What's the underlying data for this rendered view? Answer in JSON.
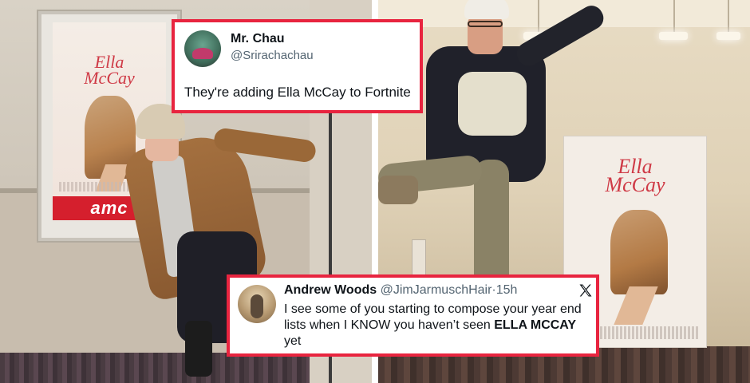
{
  "tweet_top": {
    "name": "Mr. Chau",
    "handle": "@Srirachachau",
    "text": "They're adding Ella McCay to Fortnite"
  },
  "tweet_bottom": {
    "name": "Andrew Woods",
    "handle": "@JimJarmuschHair",
    "separator": "·",
    "time": "15h",
    "text_before": "I see some of you starting to compose your year end lists when I KNOW you haven’t seen ",
    "text_bold": "ELLA MCCAY",
    "text_after": " yet"
  },
  "left_photo": {
    "poster_title_line1": "Ella",
    "poster_title_line2": "McCay",
    "theater_logo": "amc"
  },
  "right_photo": {
    "poster_title_line1": "Ella",
    "poster_title_line2": "McCay"
  },
  "colors": {
    "card_border": "#e8243f",
    "poster_title": "#cf3a46",
    "amc_red": "#d51f2d"
  }
}
